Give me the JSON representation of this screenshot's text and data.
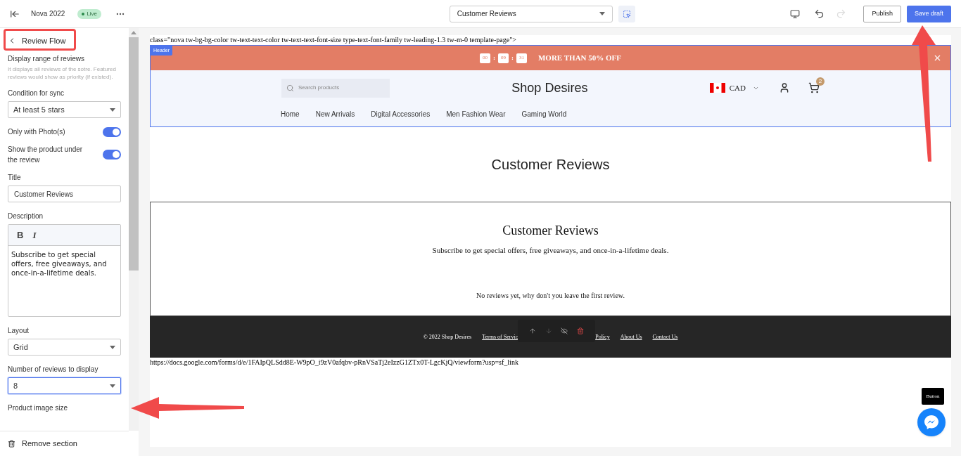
{
  "topbar": {
    "theme_name": "Nova 2022",
    "status": "Live",
    "page_select": "Customer Reviews",
    "redo_disabled": true,
    "buttons": [
      {
        "label": "Publish",
        "kind": "secondary"
      },
      {
        "label": "Save draft",
        "kind": "primary"
      }
    ]
  },
  "panel": {
    "back_title": "Review Flow",
    "range_label": "Display range of reviews",
    "range_help": "It displays all reviews of the sotre. Featured reviews would show as priority (if existed).",
    "fields": [
      {
        "kind": "select",
        "label": "Condition for sync",
        "value": "At least 5 stars",
        "focused": false
      },
      {
        "kind": "toggle",
        "label": "Only with Photo(s)",
        "on": true
      },
      {
        "kind": "toggle",
        "label": "Show the product under the review",
        "on": true
      },
      {
        "kind": "text",
        "label": "Title",
        "value": "Customer Reviews"
      },
      {
        "kind": "richtext",
        "label": "Description",
        "tools": [
          "B",
          "I"
        ],
        "value": "Subscribe to get special offers, free giveaways, and once-in-a-lifetime deals."
      },
      {
        "kind": "select",
        "label": "Layout",
        "value": "Grid",
        "focused": false
      },
      {
        "kind": "select",
        "label": "Number of reviews to display",
        "value": "8",
        "focused": true
      },
      {
        "kind": "label",
        "label": "Product image size"
      }
    ],
    "remove": "Remove section"
  },
  "preview": {
    "class_text": "class=\"nova tw-bg-bg-color tw-text-text-color tw-text-text-font-size type-text-font-family tw-leading-1.3 tw-m-0 template-page\">",
    "header_badge": "Header",
    "countdown": [
      "00",
      "09",
      "31"
    ],
    "countdown_separators": [
      ":",
      ":"
    ],
    "promo": "MORE THAN 50% OFF",
    "search_placeholder": "Search products",
    "logo": "Shop Desires",
    "currency": "CAD",
    "cart_count": "2",
    "nav": [
      "Home",
      "New Arrivals",
      "Digital Accessories",
      "Men Fashion Wear",
      "Gaming World"
    ],
    "section_title": "Customer Reviews",
    "reviews": {
      "title": "Customer Reviews",
      "subtitle": "Subscribe to get special offers, free giveaways, and once-in-a-lifetime deals.",
      "empty": "No reviews yet, why don't you leave the first review."
    },
    "footer": {
      "copyright": "© 2022 Shop Desires",
      "links": [
        "Terms of Servic",
        "Policy",
        "About Us",
        "Contact Us"
      ]
    },
    "url_text": "https://docs.google.com/forms/d/e/1FAIpQLSdd8E-W9pO_i9zV0afqbv-pRnVSaTj2eIzzG1ZTx0T-LgcKjQ/viewform?usp=sf_link",
    "float_button": "Button"
  }
}
